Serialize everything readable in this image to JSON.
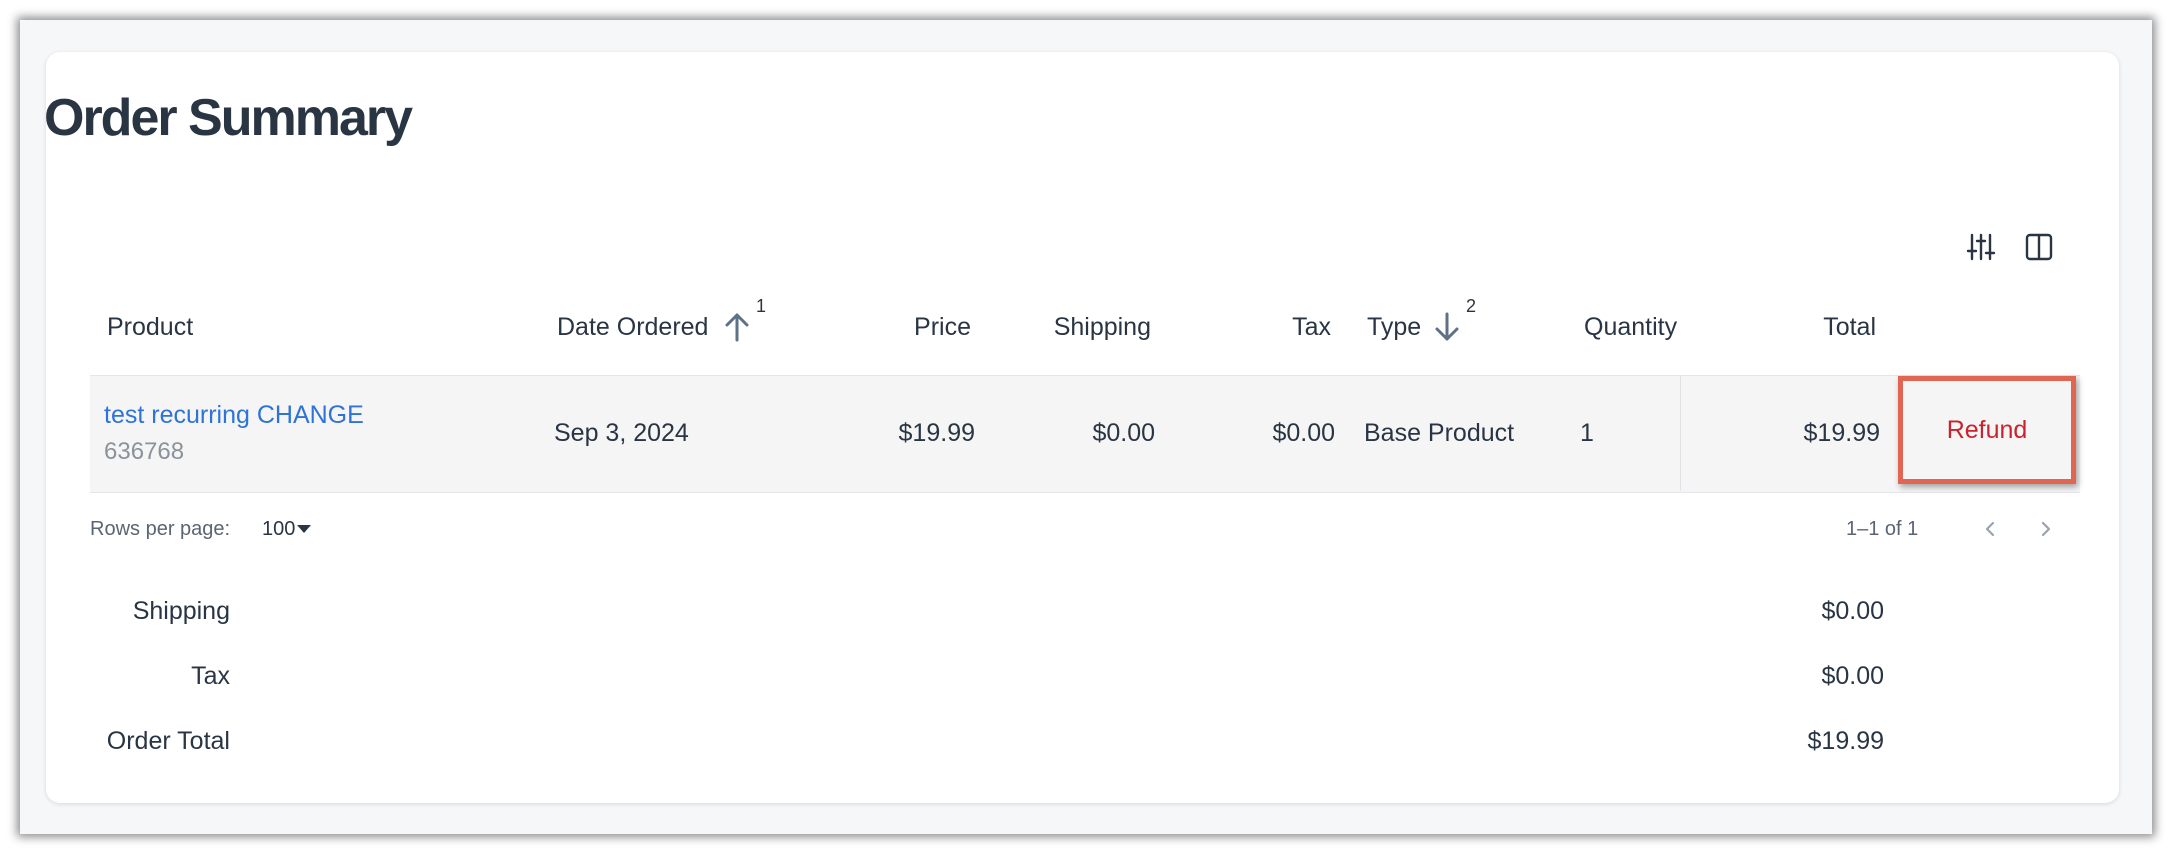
{
  "title": "Order Summary",
  "toolbar": {
    "filter_icon": "sliders-icon",
    "columns_icon": "columns-icon"
  },
  "table": {
    "headers": {
      "product": "Product",
      "date_ordered": "Date Ordered",
      "date_sort_index": "1",
      "price": "Price",
      "shipping": "Shipping",
      "tax": "Tax",
      "type": "Type",
      "type_sort_index": "2",
      "quantity": "Quantity",
      "total": "Total"
    },
    "rows": [
      {
        "product_name": "test recurring CHANGE",
        "product_id": "636768",
        "date_ordered": "Sep 3, 2024",
        "price": "$19.99",
        "shipping": "$0.00",
        "tax": "$0.00",
        "type": "Base Product",
        "quantity": "1",
        "total": "$19.99",
        "action_label": "Refund"
      }
    ]
  },
  "pagination": {
    "rows_per_page_label": "Rows per page:",
    "rows_per_page_value": "100",
    "range_text": "1–1 of 1"
  },
  "summary": {
    "shipping_label": "Shipping",
    "shipping_value": "$0.00",
    "tax_label": "Tax",
    "tax_value": "$0.00",
    "order_total_label": "Order Total",
    "order_total_value": "$19.99"
  },
  "colors": {
    "link": "#2e73d8",
    "refund_text": "#c9232f",
    "highlight_border": "#e06552",
    "heading": "#2a3544"
  }
}
